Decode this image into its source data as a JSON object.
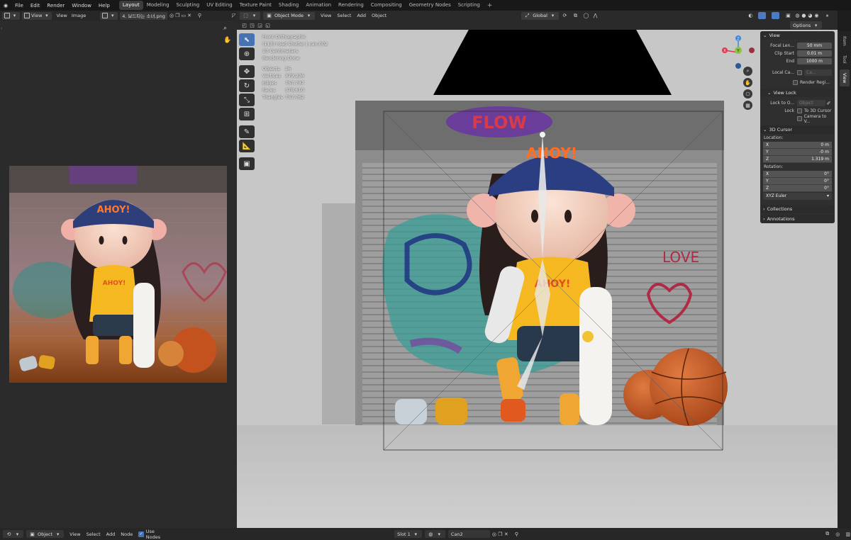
{
  "top_menu": {
    "items": [
      "File",
      "Edit",
      "Render",
      "Window",
      "Help"
    ],
    "workspaces": [
      "Layout",
      "Modeling",
      "Sculpting",
      "UV Editing",
      "Texture Paint",
      "Shading",
      "Animation",
      "Rendering",
      "Compositing",
      "Geometry Nodes",
      "Scripting"
    ],
    "active_workspace": "Layout",
    "add_workspace": "+"
  },
  "image_editor": {
    "view_label": "View",
    "menus": [
      "View",
      "Image"
    ],
    "image_name": "4. 보드타는 소녀.png"
  },
  "viewport": {
    "mode": "Object Mode",
    "menus": [
      "View",
      "Select",
      "Add",
      "Object"
    ],
    "orientation": "Global",
    "options_label": "Options",
    "overlay": {
      "view_name": "Front Orthographic",
      "collection": "(113) road shutter | can.002",
      "scale": "10 Centimeters",
      "status": "Rendering Done",
      "stats": [
        {
          "k": "Objects",
          "v": "26"
        },
        {
          "k": "Vertices",
          "v": "379,236"
        },
        {
          "k": "Edges",
          "v": "757,787"
        },
        {
          "k": "Faces",
          "v": "378,610"
        },
        {
          "k": "Triangles",
          "v": "757,062"
        }
      ]
    },
    "scene_text": {
      "shutter_tag": "FLOW",
      "hat_text": "AHOY!",
      "shirt_text": "AHOY!",
      "graffiti_love": "LOVE"
    }
  },
  "npanel": {
    "view": {
      "title": "View",
      "focal_length_label": "Focal Len...",
      "focal_length": "50 mm",
      "clip_start_label": "Clip Start",
      "clip_start": "0.01 m",
      "clip_end_label": "End",
      "clip_end": "1000 m",
      "local_camera_label": "Local Ca...",
      "local_camera_value": "Ca...",
      "render_region_label": "Render Regi..."
    },
    "view_lock": {
      "title": "View Lock",
      "lock_to_object_label": "Lock to O...",
      "lock_to_object_placeholder": "Object",
      "lock_label": "Lock",
      "to_3d_cursor": "To 3D Cursor",
      "camera_to_view": "Camera to V..."
    },
    "cursor": {
      "title": "3D Cursor",
      "location_label": "Location:",
      "location": [
        {
          "axis": "X",
          "value": "0 m"
        },
        {
          "axis": "Y",
          "value": "-0 m"
        },
        {
          "axis": "Z",
          "value": "1.319 m"
        }
      ],
      "rotation_label": "Rotation:",
      "rotation": [
        {
          "axis": "X",
          "value": "0°"
        },
        {
          "axis": "Y",
          "value": "0°"
        },
        {
          "axis": "Z",
          "value": "0°"
        }
      ],
      "rotation_mode": "XYZ Euler"
    },
    "collections": "Collections",
    "annotations": "Annotations"
  },
  "side_tabs": [
    "Item",
    "Tool",
    "View"
  ],
  "active_side_tab": "View",
  "gizmo": {
    "x": "X",
    "y": "Y",
    "z": "Z"
  },
  "bottom_bar": {
    "editor_mode": "Object",
    "menus": [
      "View",
      "Select",
      "Add",
      "Node"
    ],
    "use_nodes_label": "Use Nodes",
    "slot": "Slot 1",
    "material": "Can2"
  },
  "colors": {
    "accent": "#4772b3",
    "axis_x": "#e0384f",
    "axis_y": "#8bc540",
    "axis_z": "#3b87e0"
  }
}
